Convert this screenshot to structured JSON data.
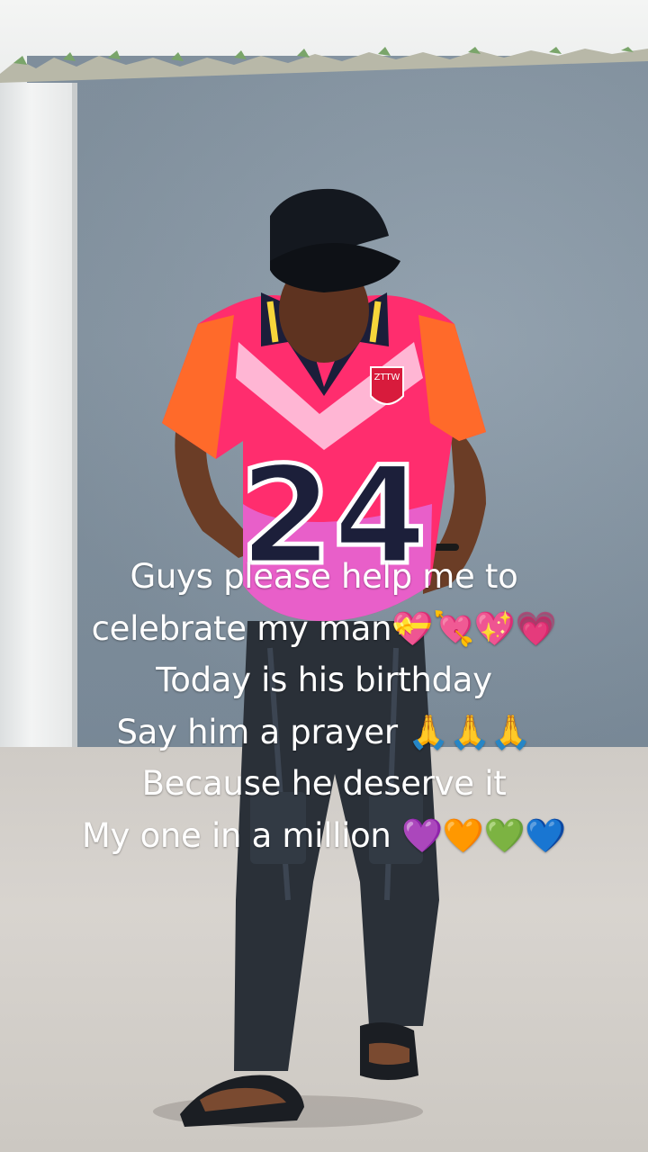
{
  "caption": {
    "lines": [
      "Guys please help me to",
      "celebrate my man💝💘💖💗",
      "Today is his birthday",
      "Say him a prayer 🙏🙏🙏",
      "Because he deserve it",
      "My one in a million 💜🧡💚💙"
    ]
  },
  "jersey": {
    "number": "24",
    "badge": "ZTTW"
  },
  "colors": {
    "wall": "#8797a5",
    "ground": "#d3cfca",
    "jersey_pink": "#ff2d6e",
    "jersey_orange": "#ff6a2a",
    "jeans": "#2a3038",
    "cap": "#14181f",
    "caption_text": "#ffffff"
  }
}
